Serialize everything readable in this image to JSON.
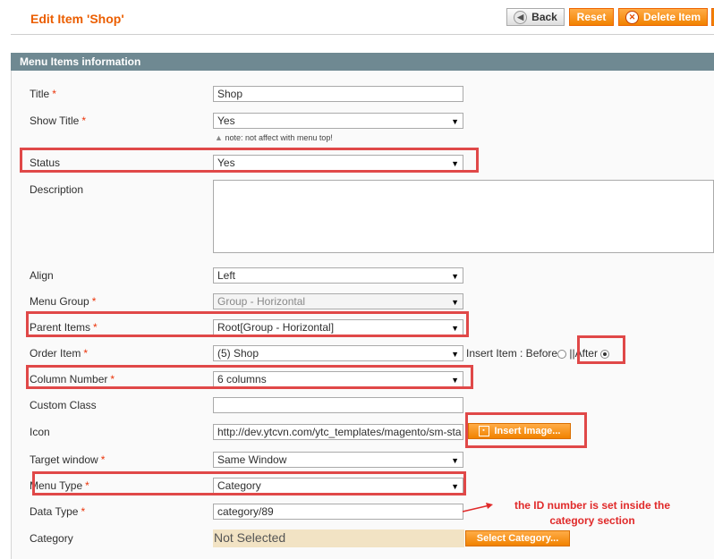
{
  "header": {
    "title": "Edit Item 'Shop'",
    "back_label": "Back",
    "reset_label": "Reset",
    "delete_label": "Delete Item"
  },
  "section": {
    "title": "Menu Items information"
  },
  "fields": {
    "title": {
      "label": "Title",
      "value": "Shop"
    },
    "show_title": {
      "label": "Show Title",
      "value": "Yes",
      "note": "note: not affect with menu top!"
    },
    "status": {
      "label": "Status",
      "value": "Yes"
    },
    "description": {
      "label": "Description",
      "value": ""
    },
    "align": {
      "label": "Align",
      "value": "Left"
    },
    "menu_group": {
      "label": "Menu Group",
      "value": "Group - Horizontal"
    },
    "parent_items": {
      "label": "Parent Items",
      "value": "Root[Group - Horizontal]"
    },
    "order_item": {
      "label": "Order Item",
      "value": "(5) Shop",
      "insert_label": "Insert Item : Before",
      "separator": "||",
      "after_label": "After",
      "selected": "After"
    },
    "column_number": {
      "label": "Column Number",
      "value": "6 columns"
    },
    "custom_class": {
      "label": "Custom Class",
      "value": ""
    },
    "icon": {
      "label": "Icon",
      "value": "http://dev.ytcvn.com/ytc_templates/magento/sm-sta",
      "button": "Insert Image..."
    },
    "target_window": {
      "label": "Target window",
      "value": "Same Window"
    },
    "menu_type": {
      "label": "Menu Type",
      "value": "Category"
    },
    "data_type": {
      "label": "Data Type",
      "value": "category/89"
    },
    "category": {
      "label": "Category",
      "value": "Not Selected",
      "button": "Select Category..."
    }
  },
  "annotation": {
    "line1": "the  ID number is set inside the",
    "line2": "category section"
  },
  "colors": {
    "accent": "#eb5e00",
    "highlight": "#e04848",
    "section_header": "#6f8992"
  },
  "icons": {
    "required": "asterisk",
    "dropdown": "triangle-down",
    "back": "arrow-left-icon",
    "delete": "x-circle-icon",
    "image": "image-icon"
  }
}
